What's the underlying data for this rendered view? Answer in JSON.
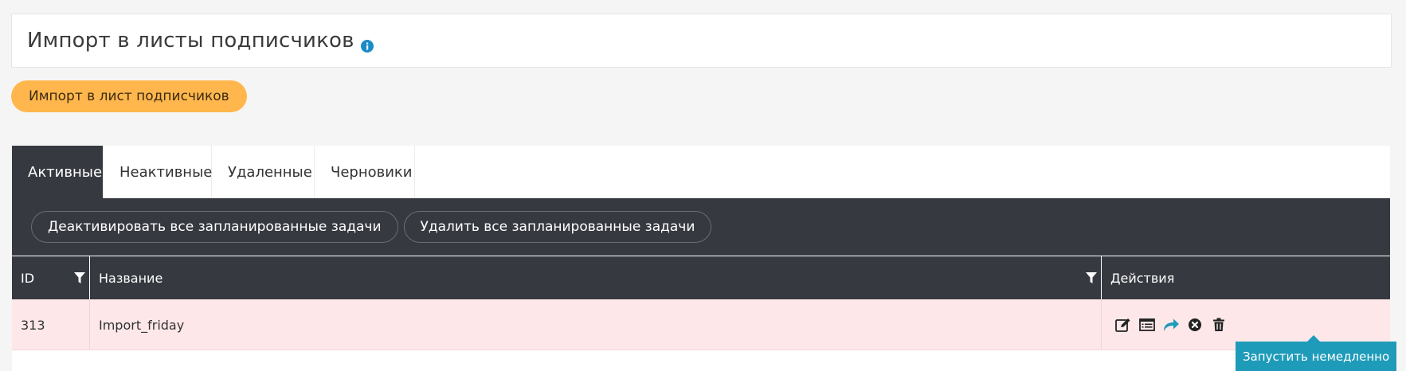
{
  "page": {
    "title": "Импорт в листы подписчиков",
    "info_icon": "info-circle-icon"
  },
  "import_button": "Импорт в лист подписчиков",
  "tabs": [
    {
      "label": "Активные",
      "active": true
    },
    {
      "label": "Неактивные",
      "active": false
    },
    {
      "label": "Удаленные",
      "active": false
    },
    {
      "label": "Черновики",
      "active": false
    }
  ],
  "toolbar": {
    "deactivate_all": "Деактивировать все запланированные задачи",
    "delete_all": "Удалить все запланированные задачи"
  },
  "table": {
    "columns": {
      "id": "ID",
      "name": "Название",
      "actions": "Действия"
    },
    "rows": [
      {
        "id": "313",
        "name": "Import_friday"
      }
    ]
  },
  "tooltip": "Запустить немедленно",
  "colors": {
    "accent_orange": "#ffb74d",
    "dark_header": "#363940",
    "row_highlight": "#fde7e9",
    "tooltip_bg": "#1e9bb9",
    "info_blue": "#1a8bc7"
  }
}
